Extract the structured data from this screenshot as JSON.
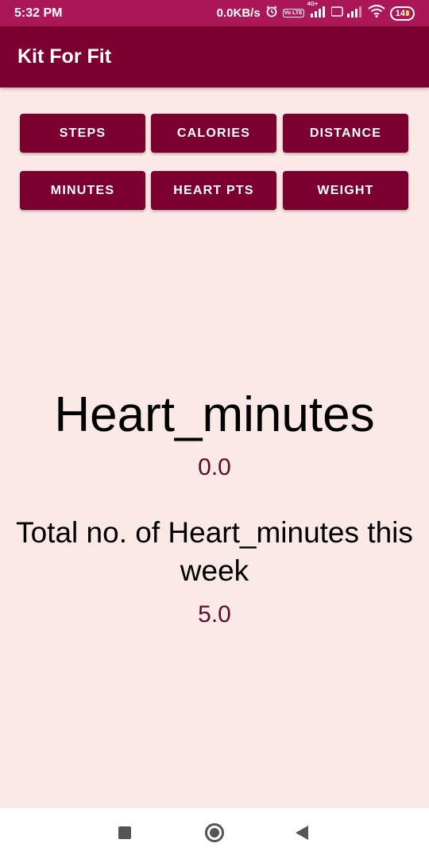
{
  "status_bar": {
    "time": "5:32 PM",
    "network_speed": "0.0KB/s",
    "volte_label": "Vo LTE",
    "network_type": "4G+",
    "battery_level": "14",
    "icons": [
      "alarm-icon",
      "volte-icon",
      "signal-icon",
      "wifi-icon",
      "battery-icon"
    ]
  },
  "app_bar": {
    "title": "Kit For Fit"
  },
  "buttons": {
    "steps": "STEPS",
    "calories": "CALORIES",
    "distance": "DISTANCE",
    "minutes": "MINUTES",
    "heart_pts": "HEART PTS",
    "weight": "WEIGHT"
  },
  "main": {
    "metric_name": "Heart_minutes",
    "today_value": "0.0",
    "week_label": "Total no. of Heart_minutes this week",
    "week_value": "5.0"
  },
  "nav_bar": {
    "icons": [
      "recent-apps-icon",
      "home-icon",
      "back-icon"
    ]
  },
  "colors": {
    "status_bar": "#ab1757",
    "primary": "#7b002f",
    "background": "#fbe9e7",
    "value_text": "#5a0e2b"
  }
}
